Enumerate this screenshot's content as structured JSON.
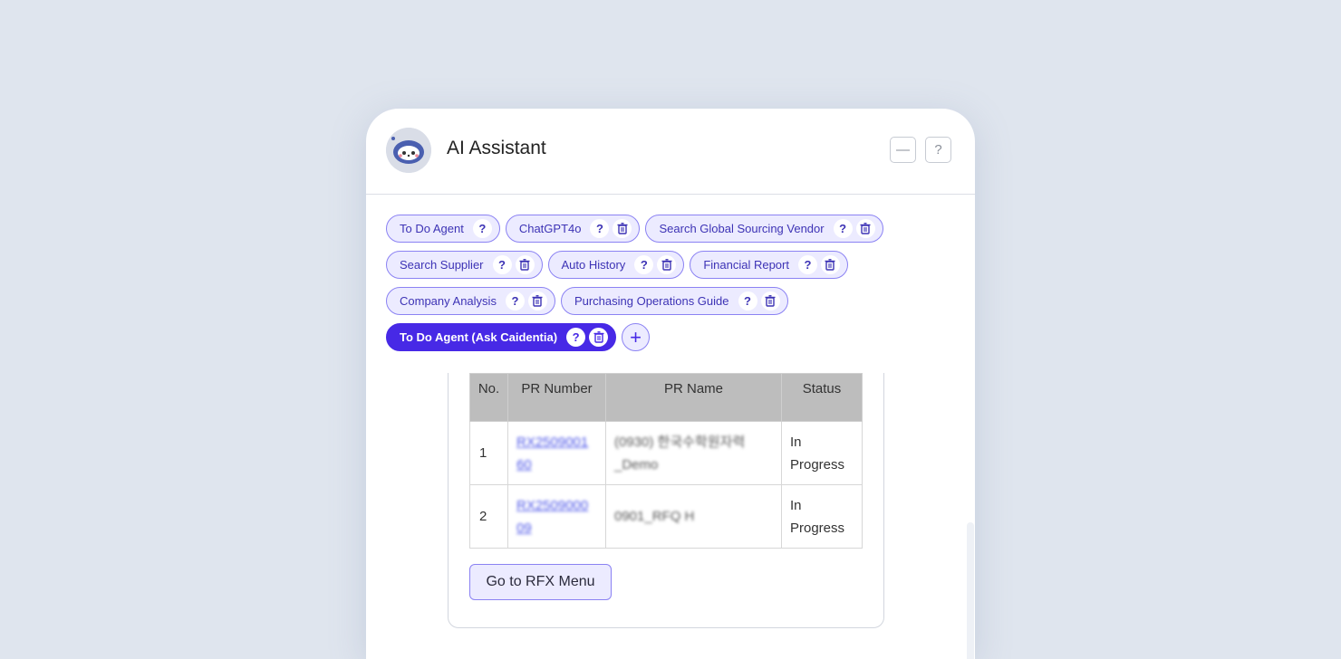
{
  "header": {
    "title": "AI Assistant",
    "minimize_icon": "minus-icon",
    "help_icon": "question-icon"
  },
  "agents": {
    "rows": [
      [
        {
          "label": "To Do Agent",
          "deletable": false
        },
        {
          "label": "ChatGPT4o",
          "deletable": true
        },
        {
          "label": "Search Global Sourcing Vendor",
          "deletable": true
        }
      ],
      [
        {
          "label": "Search Supplier",
          "deletable": true
        },
        {
          "label": "Auto History",
          "deletable": true
        },
        {
          "label": "Financial Report",
          "deletable": true
        }
      ],
      [
        {
          "label": "Company Analysis",
          "deletable": true
        },
        {
          "label": "Purchasing Operations Guide",
          "deletable": true
        }
      ],
      [
        {
          "label": "To Do Agent (Ask Caidentia)",
          "deletable": true,
          "active": true
        }
      ]
    ],
    "help_glyph": "?",
    "add_glyph": "+"
  },
  "table": {
    "headers": [
      "No.",
      "PR Number",
      "PR Name",
      "Status"
    ],
    "rows": [
      {
        "no": "1",
        "pr_number_l1": "RX2509001",
        "pr_number_l2": "60",
        "pr_name_l1": "(0930) 한국수학원자력",
        "pr_name_l2": "_Demo",
        "status_l1": "In",
        "status_l2": "Progress"
      },
      {
        "no": "2",
        "pr_number_l1": "RX2509000",
        "pr_number_l2": "09",
        "pr_name_l1": "0901_RFQ H",
        "pr_name_l2": "",
        "status_l1": "In",
        "status_l2": "Progress"
      }
    ]
  },
  "actions": {
    "rfx_button": "Go to RFX Menu"
  },
  "colors": {
    "accent": "#4729e6",
    "chip_bg": "#ecebff",
    "chip_border": "#8b82f3",
    "page_bg": "#dfe5ee"
  }
}
